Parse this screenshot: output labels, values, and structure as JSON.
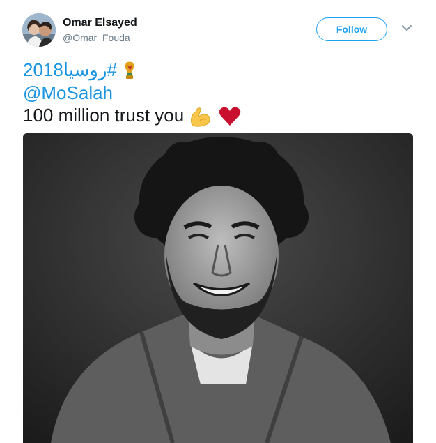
{
  "tweet": {
    "author": {
      "name": "Omar Elsayed",
      "handle": "@Omar_Fouda_"
    },
    "follow_label": "Follow",
    "text": {
      "hashtag": "#روسيا2018",
      "mention": "@MoSalah",
      "body": "100 million trust you"
    },
    "icons": [
      "world-cup-trophy-icon",
      "flexed-biceps-icon",
      "red-heart-icon",
      "chevron-down-icon"
    ],
    "colors": {
      "accent": "#1da1f2",
      "link": "#1b95e0",
      "text": "#14171a",
      "muted": "#657786"
    }
  }
}
